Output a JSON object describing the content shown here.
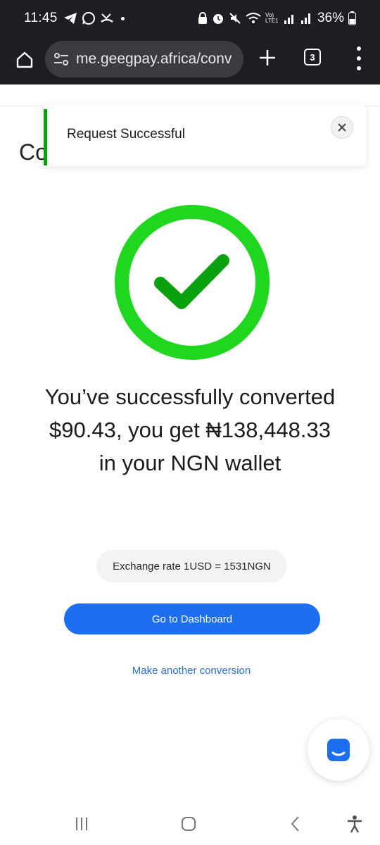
{
  "status_bar": {
    "time": "11:45",
    "battery": "36%",
    "network_label": "Vo) LTE1"
  },
  "browser": {
    "url": "me.geegpay.africa/conv",
    "tab_count": "3"
  },
  "page": {
    "heading_partial": "Co"
  },
  "toast": {
    "message": "Request Successful",
    "accent_color": "#0aa10f"
  },
  "success": {
    "message": "You’ve successfully converted $90.43, you get ₦138,448.33 in your NGN wallet",
    "icon_color": "#1fd71f"
  },
  "exchange": {
    "label": "Exchange rate 1USD = 1531NGN"
  },
  "actions": {
    "primary_label": "Go to Dashboard",
    "secondary_label": "Make another conversion",
    "primary_color": "#1d6ff2"
  },
  "icons": {
    "home": "home-icon",
    "site_settings": "tune-icon",
    "new_tab": "plus-icon",
    "tabs": "tabs-icon",
    "menu": "more-vert-icon",
    "close": "close-icon",
    "chat": "chat-icon",
    "recents": "recents-icon",
    "home_nav": "home-nav-icon",
    "back": "back-icon",
    "accessibility": "accessibility-icon"
  }
}
